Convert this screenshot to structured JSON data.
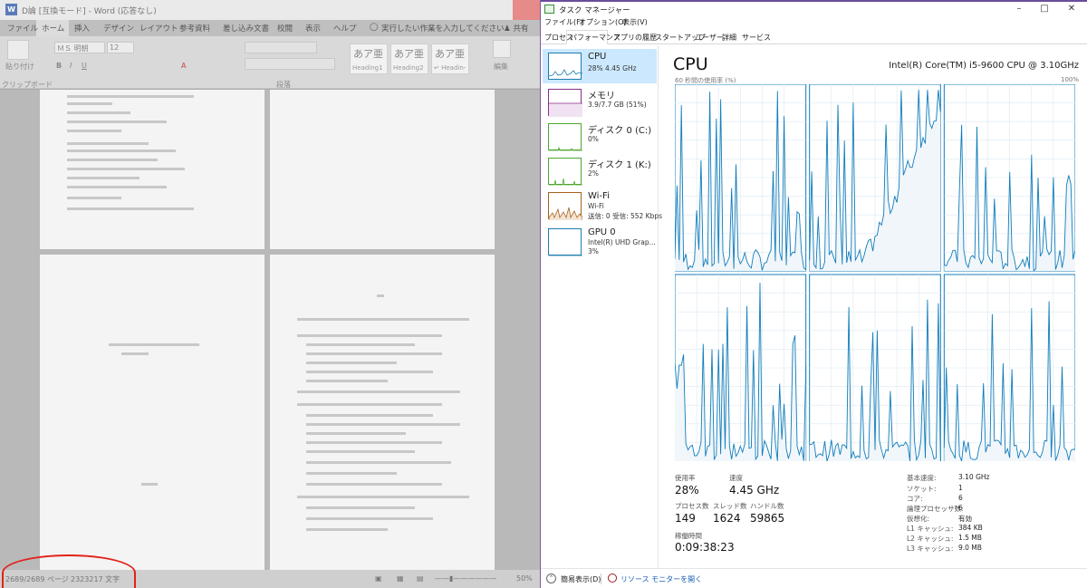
{
  "word": {
    "title": "D論 [互換モード] - Word (応答なし)",
    "tabs": [
      "ファイル",
      "ホーム",
      "挿入",
      "デザイン",
      "レイアウト",
      "参考資料",
      "差し込み文書",
      "校閲",
      "表示",
      "ヘルプ"
    ],
    "tell_me": "実行したい作業を入力してください",
    "share": "共有",
    "font_name": "ＭＳ 明朝",
    "font_size": "12",
    "paste_label": "貼り付け",
    "clipboard_label": "クリップボード",
    "paragraph_label": "段落",
    "edit_label": "編集",
    "styles": [
      {
        "sample": "あア亜",
        "name": "Heading1"
      },
      {
        "sample": "あア亜",
        "name": "Heading2"
      },
      {
        "sample": "あア亜",
        "name": "↵ Headin-"
      }
    ],
    "status_pages": "2689/2689 ページ",
    "status_words": "2323217 文字",
    "zoom": "50%"
  },
  "taskmanager": {
    "title": "タスク マネージャー",
    "menu": [
      "ファイル(F)",
      "オプション(O)",
      "表示(V)"
    ],
    "tabs": [
      "プロセス",
      "パフォーマンス",
      "アプリの履歴",
      "スタートアップ",
      "ユーザー",
      "詳細",
      "サービス"
    ],
    "sidebar": [
      {
        "name": "CPU",
        "sub1": "28% 4.45 GHz",
        "sub2": "",
        "color": "#1c7cb0"
      },
      {
        "name": "メモリ",
        "sub1": "3.9/7.7 GB (51%)",
        "sub2": "",
        "color": "#8b2e8b"
      },
      {
        "name": "ディスク 0 (C:)",
        "sub1": "0%",
        "sub2": "",
        "color": "#4ea72e"
      },
      {
        "name": "ディスク 1 (K:)",
        "sub1": "2%",
        "sub2": "",
        "color": "#4ea72e"
      },
      {
        "name": "Wi-Fi",
        "sub1": "Wi-Fi",
        "sub2": "送信: 0 受信: 552 Kbps",
        "color": "#a7611d"
      },
      {
        "name": "GPU 0",
        "sub1": "Intel(R) UHD Grap...",
        "sub2": "3%",
        "color": "#1c7cb0"
      }
    ],
    "main_title": "CPU",
    "cpu_model": "Intel(R) Core(TM) i5-9600 CPU @ 3.10GHz",
    "graph_caption": "60 秒間の使用率 (%)",
    "graph_max": "100%",
    "stats": {
      "usage_label": "使用率",
      "usage": "28%",
      "speed_label": "速度",
      "speed": "4.45 GHz",
      "processes_label": "プロセス数",
      "processes": "149",
      "threads_label": "スレッド数",
      "threads": "1624",
      "handles_label": "ハンドル数",
      "handles": "59865",
      "uptime_label": "稼働時間",
      "uptime": "0:09:38:23"
    },
    "specs": [
      {
        "label": "基本速度:",
        "value": "3.10 GHz"
      },
      {
        "label": "ソケット:",
        "value": "1"
      },
      {
        "label": "コア:",
        "value": "6"
      },
      {
        "label": "論理プロセッサ数:",
        "value": "6"
      },
      {
        "label": "仮想化:",
        "value": "有効"
      },
      {
        "label": "L1 キャッシュ:",
        "value": "384 KB"
      },
      {
        "label": "L2 キャッシュ:",
        "value": "1.5 MB"
      },
      {
        "label": "L3 キャッシュ:",
        "value": "9.0 MB"
      }
    ],
    "footer_less": "簡易表示(D)",
    "footer_resmon": "リソース モニターを開く",
    "cpu_color": "#117dbb"
  }
}
